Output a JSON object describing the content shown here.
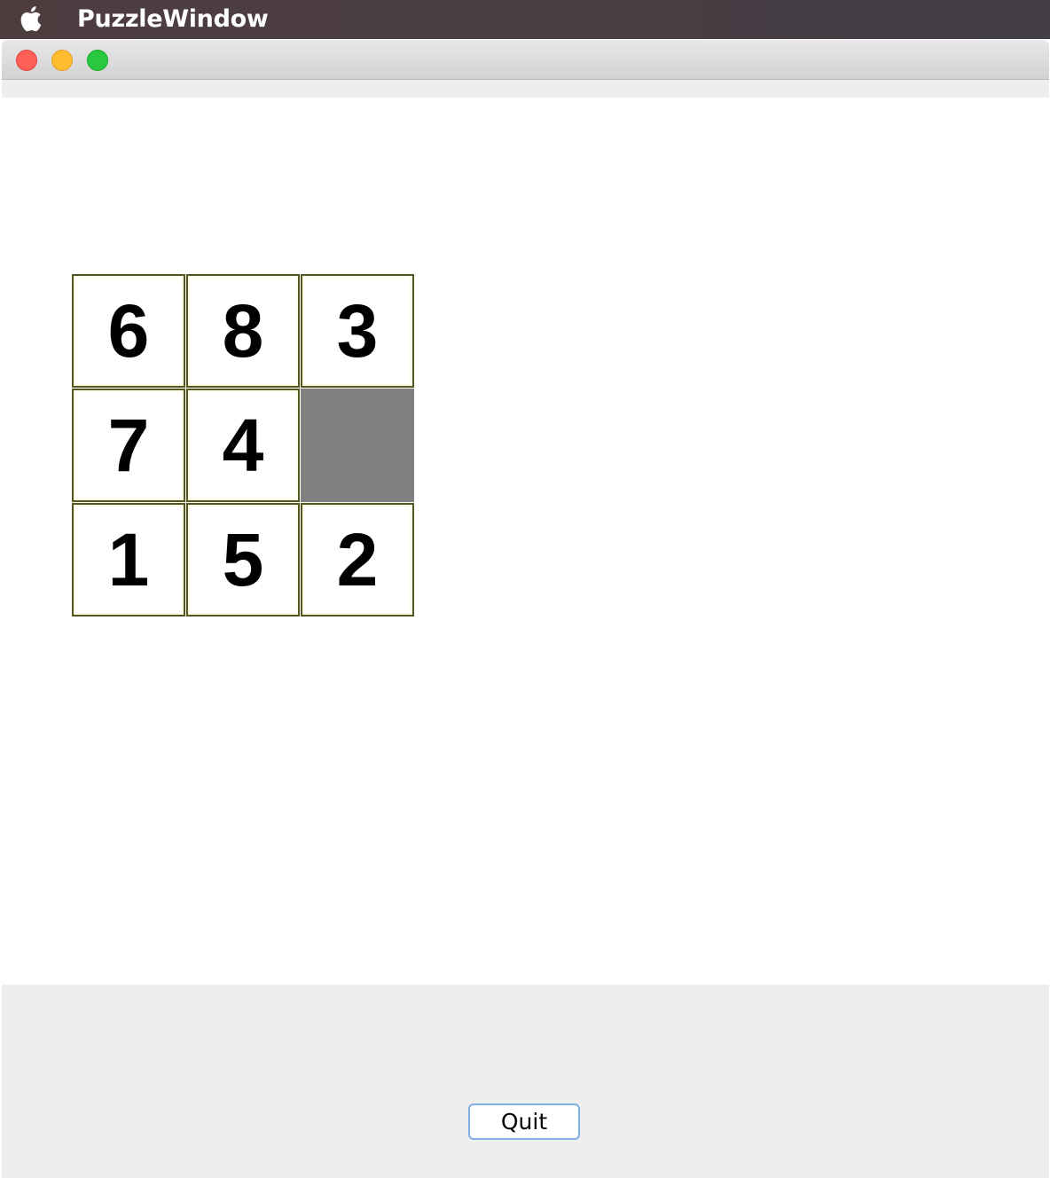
{
  "menubar": {
    "apple_icon": "apple-logo-icon",
    "app_name": "PuzzleWindow"
  },
  "window": {
    "controls": [
      "close-button",
      "minimize-button",
      "maximize-button"
    ],
    "colors": {
      "close": "#fe5f57",
      "minimize": "#febc2e",
      "maximize": "#28c840"
    }
  },
  "puzzle": {
    "rows": 3,
    "cols": 3,
    "tiles": [
      "6",
      "8",
      "3",
      "7",
      "4",
      "",
      "1",
      "5",
      "2"
    ],
    "empty_color": "#808080",
    "tile_border_color": "#55561f"
  },
  "footer": {
    "quit_label": "Quit"
  }
}
